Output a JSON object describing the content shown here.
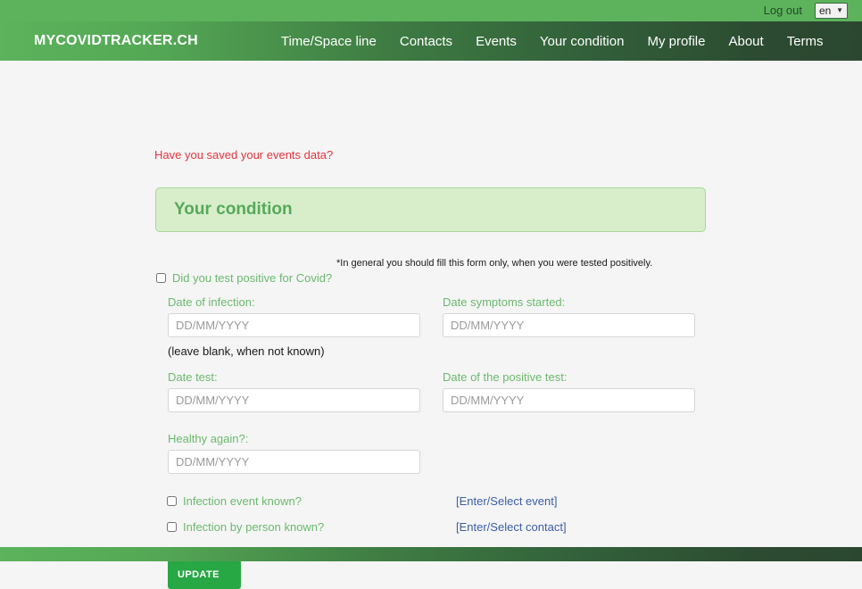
{
  "topbar": {
    "logout_label": "Log out",
    "language": {
      "selected": "en",
      "options": [
        "en"
      ],
      "chevron": "chevron-down-icon"
    }
  },
  "navbar": {
    "brand": "MYCOVIDTRACKER.CH",
    "items": [
      {
        "label": "Time/Space line"
      },
      {
        "label": "Contacts"
      },
      {
        "label": "Events"
      },
      {
        "label": "Your condition"
      },
      {
        "label": "My profile"
      },
      {
        "label": "About"
      },
      {
        "label": "Terms"
      }
    ]
  },
  "main": {
    "alert": "Have you saved your events data?",
    "panel_title": "Your condition",
    "note": "*In general you should fill this form only, when you were tested positively.",
    "hint": "(leave blank, when not known)",
    "checkboxes": {
      "tested_positive": "Did you test positive for Covid?",
      "infection_event_known": "Infection event known?",
      "infection_person_known": "Infection by person known?"
    },
    "fields": {
      "date_of_infection": {
        "label": "Date of infection:",
        "value": "",
        "placeholder": "DD/MM/YYYY"
      },
      "date_symptoms_started": {
        "label": "Date symptoms started:",
        "value": "",
        "placeholder": "DD/MM/YYYY"
      },
      "date_test": {
        "label": "Date test:",
        "value": "",
        "placeholder": "DD/MM/YYYY"
      },
      "date_positive_test": {
        "label": "Date of the positive test:",
        "value": "",
        "placeholder": "DD/MM/YYYY"
      },
      "healthy_again": {
        "label": "Healthy again?:",
        "value": "",
        "placeholder": "DD/MM/YYYY"
      }
    },
    "links": {
      "select_event": "[Enter/Select event]",
      "select_contact": "[Enter/Select contact]"
    },
    "update_button": "UPDATE"
  },
  "colors": {
    "brand_green": "#5cb35c",
    "nav_dark_green": "#2b4730",
    "label_green": "#6cb96f",
    "panel_bg": "#d8eecb",
    "panel_border": "#a9d69a",
    "panel_title": "#56a95a",
    "alert_red": "#e8343d",
    "link_blue": "#3b5fa8",
    "button_green": "#28a745",
    "page_bg": "#f5f5f5"
  }
}
